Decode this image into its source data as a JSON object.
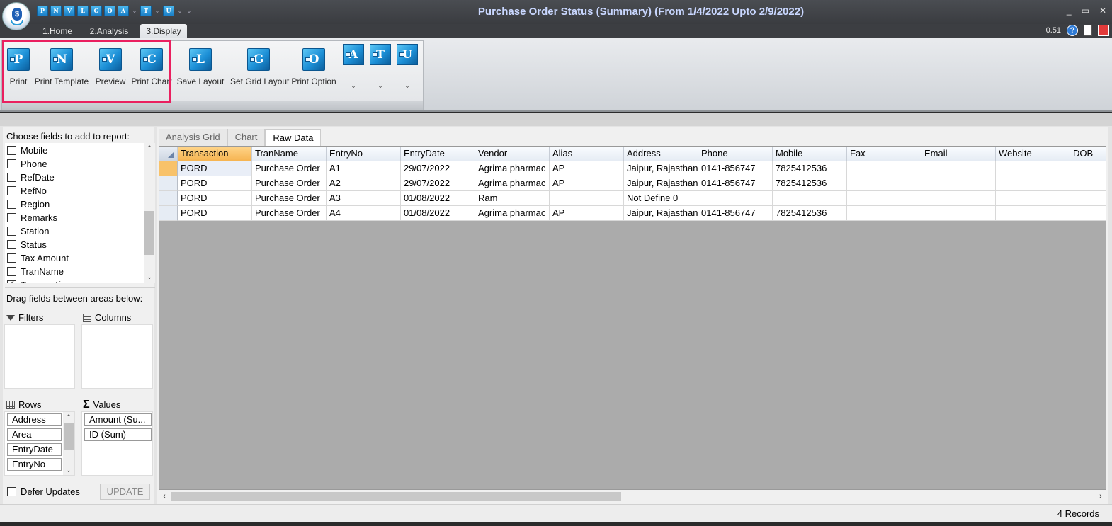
{
  "titlebar": {
    "title": "Purchase Order Status (Summary)  (From 1/4/2022 Upto 2/9/2022)",
    "qat_buttons": [
      "P",
      "N",
      "V",
      "L",
      "G",
      "O",
      "A",
      "T",
      "U"
    ],
    "minimize": "_",
    "maximize": "▭",
    "close": "✕"
  },
  "ribbon_tabs": [
    "1.Home",
    "2.Analysis",
    "3.Display"
  ],
  "version": "0.51",
  "ribbon": {
    "buttons": [
      {
        "letter": "P",
        "label": "Print"
      },
      {
        "letter": "N",
        "label": "Print Template"
      },
      {
        "letter": "V",
        "label": "Preview"
      },
      {
        "letter": "C",
        "label": "Print Chart"
      },
      {
        "letter": "L",
        "label": "Save Layout"
      },
      {
        "letter": "G",
        "label": "Set Grid Layout"
      },
      {
        "letter": "O",
        "label": "Print Option"
      }
    ],
    "small_buttons": [
      {
        "letter": "A",
        "caret": "⌄"
      },
      {
        "letter": "T",
        "caret": "⌄"
      },
      {
        "letter": "U",
        "caret": "⌄"
      }
    ]
  },
  "field_panel": {
    "title": "Choose fields to add to report:",
    "fields": [
      {
        "label": "Mobile",
        "checked": false
      },
      {
        "label": "Phone",
        "checked": false
      },
      {
        "label": "RefDate",
        "checked": false
      },
      {
        "label": "RefNo",
        "checked": false
      },
      {
        "label": "Region",
        "checked": false
      },
      {
        "label": "Remarks",
        "checked": false
      },
      {
        "label": "Station",
        "checked": false
      },
      {
        "label": "Status",
        "checked": false
      },
      {
        "label": "Tax Amount",
        "checked": false
      },
      {
        "label": "TranName",
        "checked": false
      },
      {
        "label": "Transaction",
        "checked": true
      }
    ],
    "drag_title": "Drag fields between areas below:",
    "filters_label": "Filters",
    "columns_label": "Columns",
    "rows_label": "Rows",
    "values_label": "Values",
    "rows": [
      "Address",
      "Area",
      "EntryDate",
      "EntryNo"
    ],
    "values": [
      "Amount (Su...",
      "ID (Sum)"
    ],
    "defer_label": "Defer Updates",
    "update_label": "UPDATE"
  },
  "grid_tabs": [
    "Analysis Grid",
    "Chart",
    "Raw Data"
  ],
  "grid": {
    "columns": [
      "Transaction",
      "TranName",
      "EntryNo",
      "EntryDate",
      "Vendor",
      "Alias",
      "Address",
      "Phone",
      "Mobile",
      "Fax",
      "Email",
      "Website",
      "DOB"
    ],
    "rows": [
      [
        "PORD",
        "Purchase Order",
        "A1",
        "29/07/2022",
        "Agrima pharmac",
        "AP",
        "Jaipur, Rajasthan",
        "0141-856747",
        "7825412536",
        "",
        "",
        "",
        ""
      ],
      [
        "PORD",
        "Purchase Order",
        "A2",
        "29/07/2022",
        "Agrima pharmac",
        "AP",
        "Jaipur, Rajasthan",
        "0141-856747",
        "7825412536",
        "",
        "",
        "",
        ""
      ],
      [
        "PORD",
        "Purchase Order",
        "A3",
        "01/08/2022",
        "Ram",
        "",
        " Not Define 0",
        "",
        "",
        "",
        "",
        "",
        ""
      ],
      [
        "PORD",
        "Purchase Order",
        "A4",
        "01/08/2022",
        "Agrima pharmac",
        "AP",
        "Jaipur, Rajasthan",
        "0141-856747",
        "7825412536",
        "",
        "",
        "",
        ""
      ]
    ]
  },
  "status": {
    "records": "4 Records"
  }
}
